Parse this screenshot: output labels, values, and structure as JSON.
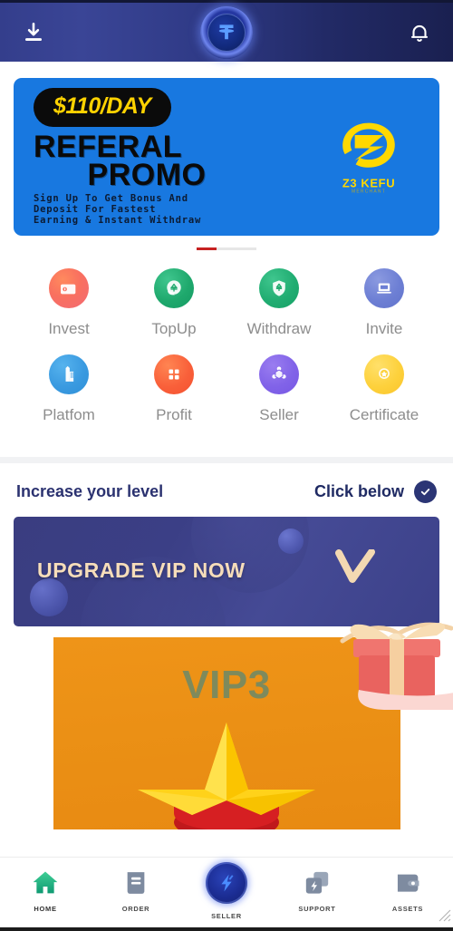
{
  "header": {
    "download_icon": "download-icon",
    "logo_icon": "tether-logo-icon",
    "bell_icon": "bell-icon"
  },
  "promo_banner": {
    "badge": "$110/DAY",
    "title_line1": "REFERAL",
    "title_line2": "PROMO",
    "sub_line1": "Sign Up To Get Bonus And",
    "sub_line2": "Deposit For Fastest",
    "sub_line3": "Earning & Instant Withdraw",
    "brand_name": "Z3 KEFU",
    "brand_tagline": "MERCHANT",
    "bg_color": "#1878e0",
    "badge_bg": "#0b0b0b",
    "badge_color": "#ffd200",
    "brand_color": "#ffd800"
  },
  "carousel": {
    "active_index": 0,
    "count": 3,
    "active_color": "#c62121",
    "inactive_color": "#e6e6e6"
  },
  "menu": {
    "rows": [
      [
        {
          "label": "Invest",
          "icon": "wallet-icon"
        },
        {
          "label": "TopUp",
          "icon": "yen-coin-icon"
        },
        {
          "label": "Withdraw",
          "icon": "shield-yen-icon"
        },
        {
          "label": "Invite",
          "icon": "invite-person-icon"
        }
      ],
      [
        {
          "label": "Platfom",
          "icon": "building-icon"
        },
        {
          "label": "Profit",
          "icon": "grid-squares-icon"
        },
        {
          "label": "Seller",
          "icon": "network-group-icon"
        },
        {
          "label": "Certificate",
          "icon": "medal-star-icon"
        }
      ]
    ]
  },
  "level_section": {
    "title": "Increase your level",
    "cta": "Click below",
    "check_icon": "check-circle-icon",
    "accent_color": "#2b3575"
  },
  "vip_banner": {
    "title": "UPGRADE VIP NOW",
    "gift_icon": "gift-box-icon",
    "v_icon": "v-check-icon",
    "bg_color": "#3b3f86",
    "title_color": "#f6ddba"
  },
  "vip_card": {
    "level_label": "VIP3",
    "star_icon": "gold-star-icon",
    "bg_color": "#ef9418",
    "text_color": "#7e8a5c"
  },
  "bottom_nav": {
    "items": [
      {
        "label": "HOME",
        "icon": "home-icon",
        "active": true
      },
      {
        "label": "ORDER",
        "icon": "order-document-icon",
        "active": false
      },
      {
        "label": "SELLER",
        "icon": "seller-lightning-icon",
        "active": false
      },
      {
        "label": "SUPPORT",
        "icon": "support-stack-icon",
        "active": false
      },
      {
        "label": "ASSETS",
        "icon": "wallet-assets-icon",
        "active": false
      }
    ],
    "active_color": "#1aa97e",
    "inactive_color": "#7e8ba0"
  }
}
